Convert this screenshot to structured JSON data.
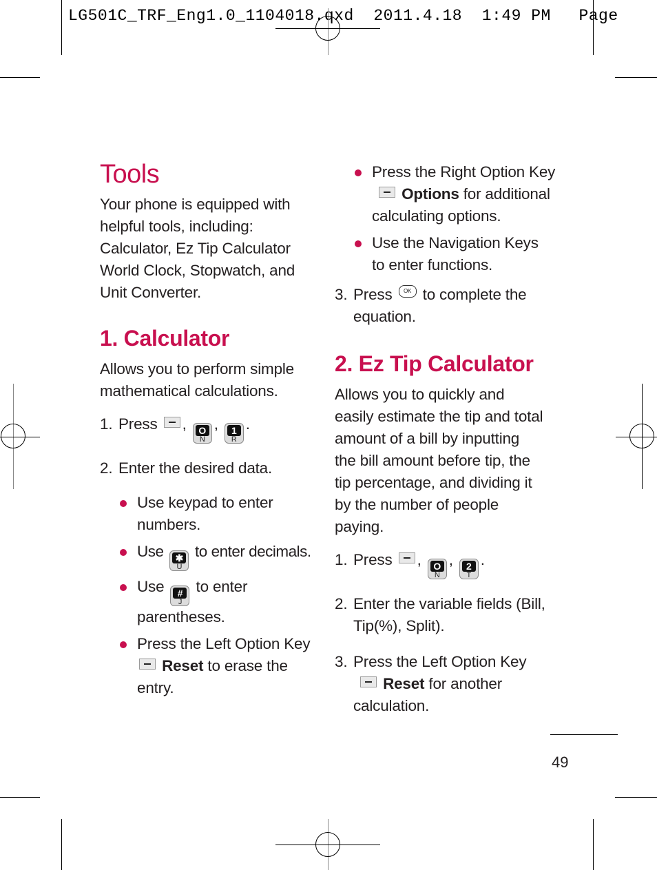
{
  "slug": {
    "filename": "LG501C_TRF_Eng1.0_1104018.qxd",
    "date": "2011.4.18",
    "time": "1:49 PM",
    "page_label": "Page"
  },
  "page_title": "Tools",
  "intro": [
    "Your phone is equipped with",
    "helpful tools, including:",
    "Calculator, Ez Tip Calculator",
    "World Clock, Stopwatch, and",
    "Unit Converter."
  ],
  "calculator": {
    "heading": "1. Calculator",
    "desc": [
      "Allows you to perform simple",
      "mathematical calculations."
    ],
    "step1": {
      "num": "1.",
      "text": "Press",
      "keys": [
        {
          "icon": "left-soft-key-icon"
        },
        {
          "icon": "key-0-icon",
          "top": "O",
          "bottom": "N"
        },
        {
          "icon": "key-1-icon",
          "top": "1",
          "bottom": "R"
        }
      ]
    },
    "step2": {
      "num": "2.",
      "text": "Enter the desired data."
    },
    "bullets": [
      {
        "lines": [
          "Use keypad to enter",
          "numbers."
        ]
      },
      {
        "pre": "Use",
        "key": {
          "icon": "key-star-icon",
          "top": "✱",
          "bottom": "U"
        },
        "post": "to enter decimals."
      },
      {
        "pre": "Use",
        "key": {
          "icon": "key-hash-icon",
          "top": "#",
          "bottom": "J"
        },
        "post": "to enter",
        "line2": "parentheses."
      },
      {
        "line1": "Press the Left Option Key",
        "bold": "Reset",
        "post": "to erase the",
        "line3": "entry."
      }
    ]
  },
  "calc_cont": {
    "bullets": [
      {
        "line1": "Press the Right Option Key",
        "bold": "Options",
        "post": "for additional",
        "line3": "calculating options."
      },
      {
        "lines": [
          "Use the Navigation Keys",
          "to enter functions."
        ]
      }
    ],
    "step3": {
      "num": "3.",
      "pre": "Press",
      "key_label": "OK",
      "post": "to complete the",
      "line2": "equation."
    }
  },
  "ez_tip": {
    "heading": "2. Ez Tip Calculator",
    "desc": [
      "Allows you to quickly and",
      "easily estimate the tip and total",
      "amount of a bill by inputting",
      "the bill amount before tip, the",
      "tip percentage, and dividing it",
      "by the number of people",
      "paying."
    ],
    "step1": {
      "num": "1.",
      "text": "Press",
      "keys": [
        {
          "icon": "left-soft-key-icon"
        },
        {
          "icon": "key-0-icon",
          "top": "O",
          "bottom": "N"
        },
        {
          "icon": "key-2-icon",
          "top": "2",
          "bottom": "T"
        }
      ]
    },
    "step2": {
      "num": "2.",
      "lines": [
        "Enter the variable fields (Bill,",
        "Tip(%), Split)."
      ]
    },
    "step3": {
      "num": "3.",
      "line1": "Press the Left Option Key",
      "bold": "Reset",
      "post": "for another",
      "line3": "calculation."
    }
  },
  "page_number": "49",
  "colors": {
    "accent": "#c8104f",
    "text": "#231f20"
  }
}
